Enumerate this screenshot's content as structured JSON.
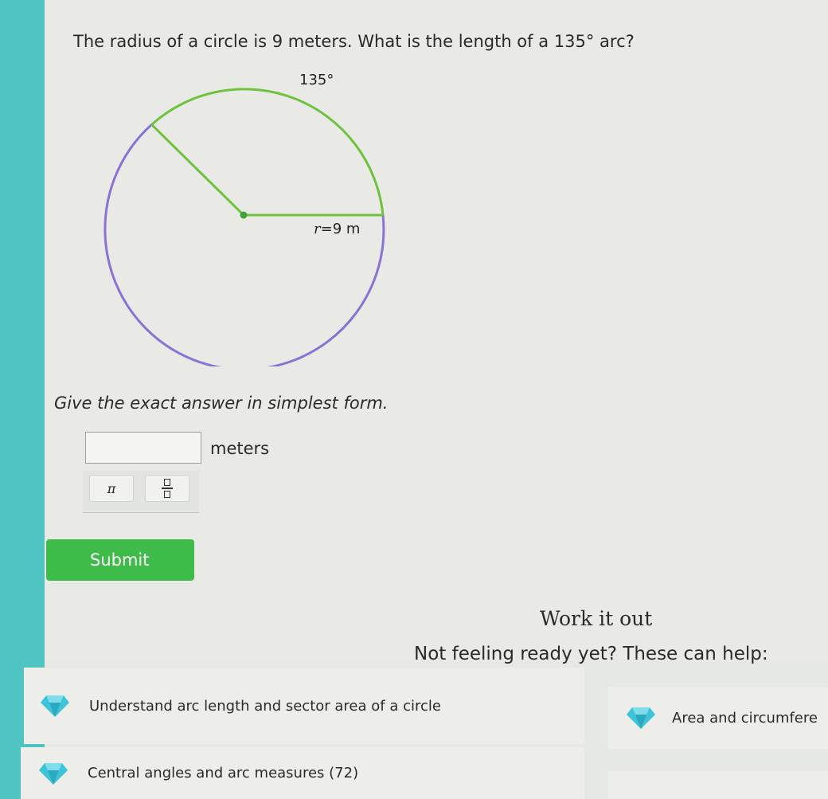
{
  "question": {
    "text": "The radius of a circle is 9 meters. What is the length of a 135° arc?"
  },
  "diagram": {
    "arc_angle_label": "135°",
    "radius_label_var": "r",
    "radius_label_value": "=9 m",
    "colors": {
      "arc": "#6ec23e",
      "circle": "#8a72d6",
      "center": "#3fa33a"
    }
  },
  "instructions": "Give the exact answer in simplest form.",
  "answer": {
    "value": "",
    "unit": "meters"
  },
  "toolbar": {
    "pi_label": "π"
  },
  "submit_label": "Submit",
  "help": {
    "heading": "Work it out",
    "subtitle": "Not feeling ready yet? These can help:",
    "items": [
      {
        "label": "Understand arc length and sector area of a circle",
        "icon": "diamond-icon"
      },
      {
        "label": "Area and circumfere",
        "icon": "diamond-icon"
      },
      {
        "label": "Central angles and arc measures (72)",
        "icon": "diamond-icon"
      }
    ]
  },
  "colors": {
    "accent": "#4fc4c2",
    "submit": "#3fbb4a",
    "gem": "#3ec3d8"
  }
}
